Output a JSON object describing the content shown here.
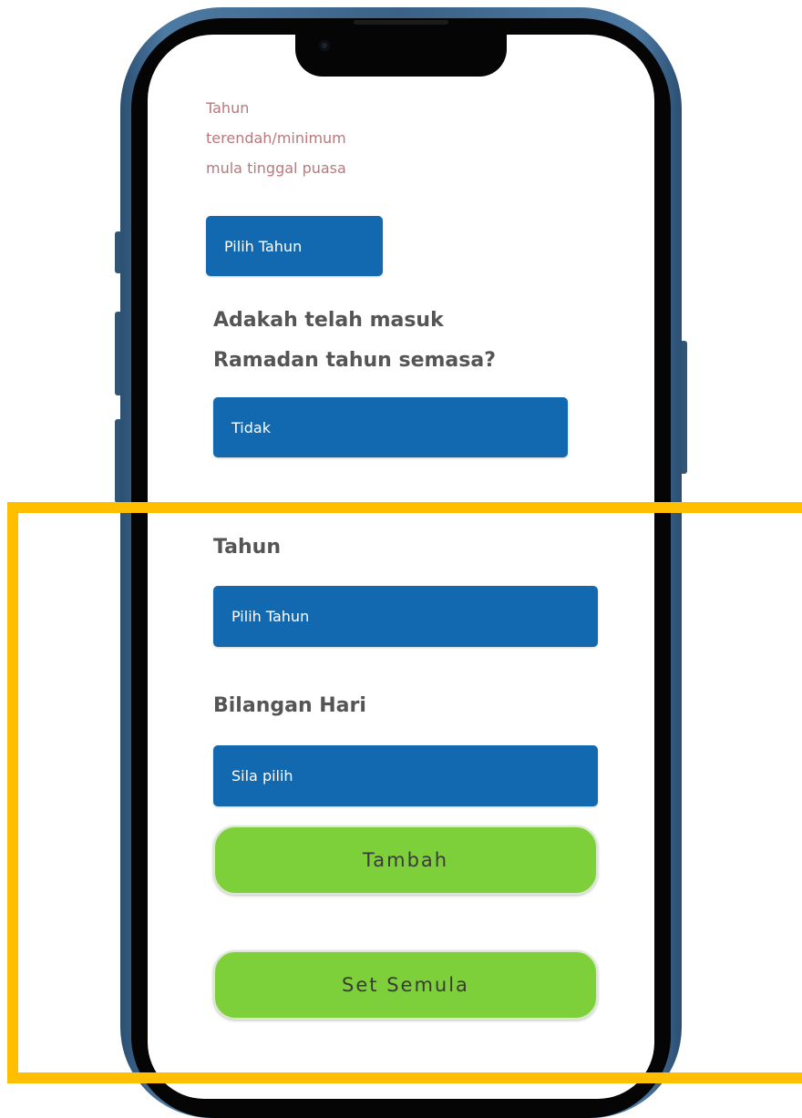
{
  "colors": {
    "highlight": "#ffbf00",
    "select_bg": "#1269b0",
    "button_bg": "#7ed03a",
    "hint_text": "#b9787c",
    "phone_frame": "#3b6286"
  },
  "form": {
    "min_year_label": "Tahun terendah/minimum mula tinggal puasa",
    "min_year_select": "Pilih Tahun",
    "ramadan_question": "Adakah telah masuk Ramadan tahun semasa?",
    "ramadan_select": "Tidak",
    "year_label": "Tahun",
    "year_select": "Pilih Tahun",
    "days_label": "Bilangan Hari",
    "days_select": "Sila pilih",
    "add_button": "Tambah",
    "reset_button": "Set Semula"
  },
  "icons": {
    "camera": "front-camera-icon"
  }
}
